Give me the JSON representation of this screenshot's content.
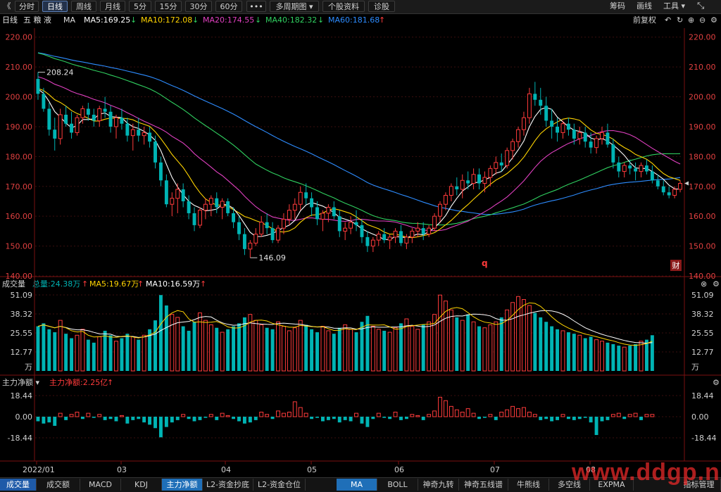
{
  "toolbar": {
    "collapse_glyph": "《",
    "periods": [
      "分时",
      "日线",
      "周线",
      "月线",
      "5分",
      "15分",
      "30分",
      "60分",
      "•••",
      "多周期图 ▾",
      "个股资料",
      "诊股"
    ],
    "selected_period": "日线",
    "right_items": [
      "筹码",
      "画线",
      "工具 ▾"
    ],
    "expand_glyph": "⤡"
  },
  "main_info": {
    "period_label": "日线",
    "stock_name": "五 粮 液",
    "indicator": "MA",
    "ma5": "MA5:169.25",
    "ma10": "MA10:172.08",
    "ma20": "MA20:174.55",
    "ma40": "MA40:182.32",
    "ma60": "MA60:181.68",
    "ma5_arrow": "↓",
    "ma10_arrow": "↓",
    "ma20_arrow": "↓",
    "ma40_arrow": "↓",
    "ma60_arrow": "↑",
    "adjust": "前复权"
  },
  "price_chart": {
    "y_ticks": [
      "220.00",
      "210.00",
      "200.00",
      "190.00",
      "180.00",
      "170.00",
      "160.00",
      "150.00",
      "140.00"
    ],
    "y_range": [
      140,
      223
    ],
    "high_label": "208.24",
    "low_label": "146.09",
    "q_marker": "q",
    "fin_marker": "财"
  },
  "volume_info": {
    "label": "成交量",
    "total": "总量:24.38万",
    "total_arrow": "↑",
    "ma5": "MA5:19.67万",
    "ma5_arrow": "↑",
    "ma10": "MA10:16.59万",
    "ma10_arrow": "↑"
  },
  "volume_chart": {
    "y_ticks": [
      "51.09",
      "38.32",
      "25.55",
      "12.77",
      "万"
    ],
    "y_range": [
      0,
      51.09
    ]
  },
  "fund_info": {
    "label": "主力净额 ▾",
    "value": "主力净额:2.25亿",
    "value_arrow": "↑"
  },
  "fund_chart": {
    "y_ticks": [
      "18.44",
      "0.00",
      "-18.44"
    ],
    "y_range": [
      -18.44,
      18.44
    ]
  },
  "date_axis": [
    "2022/01",
    "03",
    "04",
    "05",
    "06",
    "07",
    "08"
  ],
  "bottom_tabs_left": [
    "成交量",
    "成交额",
    "MACD",
    "KDJ",
    "主力净额",
    "L2-资金抄底",
    "L2-资金仓位"
  ],
  "bottom_tabs_right": [
    "MA",
    "BOLL",
    "神奇九转",
    "神奇五线谱",
    "牛熊线",
    "多空线",
    "EXPMA",
    "指标管理"
  ],
  "watermark": "www.ddgp.net",
  "colors": {
    "up": "#ff3b3b",
    "down": "#00b4b4",
    "ma5": "#ffffff",
    "ma10": "#ffd400",
    "ma20": "#e040c0",
    "ma40": "#30d060",
    "ma60": "#2d8cff",
    "accent": "#1e5aa8"
  },
  "chart_data": {
    "type": "candlestick",
    "title": "五粮液 日线",
    "ohlc": [
      [
        206,
        208.24,
        199,
        201
      ],
      [
        201,
        203,
        195,
        196
      ],
      [
        196,
        198,
        187,
        189
      ],
      [
        189,
        193,
        182,
        186
      ],
      [
        186,
        196,
        184,
        194
      ],
      [
        194,
        197,
        190,
        191
      ],
      [
        191,
        195,
        186,
        188
      ],
      [
        188,
        194,
        187,
        193
      ],
      [
        193,
        197,
        191,
        196
      ],
      [
        196,
        198,
        192,
        194
      ],
      [
        194,
        196,
        190,
        192
      ],
      [
        192,
        197,
        190,
        196
      ],
      [
        196,
        200,
        193,
        195
      ],
      [
        195,
        197,
        188,
        190
      ],
      [
        190,
        194,
        186,
        193
      ],
      [
        193,
        196,
        189,
        191
      ],
      [
        191,
        193,
        185,
        187
      ],
      [
        187,
        191,
        182,
        189
      ],
      [
        189,
        193,
        185,
        187
      ],
      [
        187,
        190,
        184,
        188
      ],
      [
        188,
        190,
        183,
        185
      ],
      [
        185,
        187,
        176,
        178
      ],
      [
        178,
        180,
        170,
        172
      ],
      [
        172,
        174,
        163,
        164
      ],
      [
        164,
        168,
        160,
        166
      ],
      [
        166,
        171,
        161,
        169
      ],
      [
        169,
        171,
        163,
        165
      ],
      [
        165,
        167,
        159,
        161
      ],
      [
        161,
        163,
        155,
        157
      ],
      [
        157,
        163,
        156,
        162
      ],
      [
        162,
        166,
        159,
        164
      ],
      [
        164,
        167,
        160,
        166
      ],
      [
        166,
        168,
        161,
        163
      ],
      [
        163,
        166,
        159,
        165
      ],
      [
        165,
        166,
        160,
        161
      ],
      [
        161,
        163,
        156,
        158
      ],
      [
        158,
        160,
        152,
        154
      ],
      [
        154,
        156,
        147,
        149
      ],
      [
        149,
        152,
        146.09,
        151
      ],
      [
        151,
        156,
        150,
        154
      ],
      [
        154,
        160,
        153,
        158
      ],
      [
        158,
        161,
        154,
        156
      ],
      [
        156,
        158,
        151,
        152
      ],
      [
        152,
        157,
        151,
        156
      ],
      [
        156,
        161,
        154,
        159
      ],
      [
        159,
        164,
        157,
        162
      ],
      [
        162,
        166,
        159,
        164
      ],
      [
        164,
        170,
        162,
        168
      ],
      [
        168,
        171,
        164,
        166
      ],
      [
        166,
        168,
        160,
        163
      ],
      [
        163,
        165,
        157,
        159
      ],
      [
        159,
        162,
        155,
        161
      ],
      [
        161,
        164,
        158,
        163
      ],
      [
        163,
        165,
        159,
        160
      ],
      [
        160,
        162,
        153,
        155
      ],
      [
        155,
        158,
        152,
        156
      ],
      [
        156,
        160,
        154,
        158
      ],
      [
        158,
        162,
        155,
        157
      ],
      [
        157,
        159,
        151,
        153
      ],
      [
        153,
        155,
        148,
        150
      ],
      [
        150,
        153,
        148,
        152
      ],
      [
        152,
        155,
        150,
        154
      ],
      [
        154,
        156,
        151,
        152
      ],
      [
        152,
        154,
        149,
        153
      ],
      [
        153,
        156,
        151,
        155
      ],
      [
        155,
        157,
        150,
        151
      ],
      [
        151,
        154,
        149,
        153
      ],
      [
        153,
        156,
        151,
        155
      ],
      [
        155,
        158,
        153,
        156
      ],
      [
        156,
        158,
        152,
        154
      ],
      [
        154,
        157,
        153,
        156
      ],
      [
        156,
        161,
        155,
        160
      ],
      [
        160,
        165,
        158,
        164
      ],
      [
        164,
        168,
        162,
        167
      ],
      [
        167,
        171,
        165,
        170
      ],
      [
        170,
        173,
        167,
        169
      ],
      [
        169,
        174,
        166,
        172
      ],
      [
        172,
        175,
        169,
        171
      ],
      [
        171,
        176,
        169,
        174
      ],
      [
        174,
        176,
        169,
        171
      ],
      [
        171,
        175,
        168,
        173
      ],
      [
        173,
        177,
        170,
        176
      ],
      [
        176,
        180,
        174,
        178
      ],
      [
        178,
        181,
        175,
        177
      ],
      [
        177,
        183,
        176,
        182
      ],
      [
        182,
        186,
        179,
        185
      ],
      [
        185,
        190,
        183,
        189
      ],
      [
        189,
        195,
        187,
        193
      ],
      [
        193,
        203,
        191,
        201
      ],
      [
        201,
        205,
        197,
        199
      ],
      [
        199,
        203,
        194,
        197
      ],
      [
        197,
        200,
        190,
        192
      ],
      [
        192,
        196,
        186,
        190
      ],
      [
        190,
        193,
        185,
        188
      ],
      [
        188,
        192,
        186,
        191
      ],
      [
        191,
        193,
        187,
        189
      ],
      [
        189,
        191,
        184,
        186
      ],
      [
        186,
        190,
        184,
        188
      ],
      [
        188,
        190,
        183,
        185
      ],
      [
        185,
        188,
        181,
        183
      ],
      [
        183,
        187,
        181,
        186
      ],
      [
        186,
        190,
        184,
        188
      ],
      [
        188,
        191,
        183,
        184
      ],
      [
        184,
        186,
        176,
        178
      ],
      [
        178,
        180,
        173,
        175
      ],
      [
        175,
        178,
        173,
        177
      ],
      [
        177,
        179,
        174,
        176
      ],
      [
        176,
        178,
        172,
        175
      ],
      [
        175,
        178,
        173,
        177
      ],
      [
        177,
        179,
        174,
        175
      ],
      [
        175,
        177,
        171,
        172
      ],
      [
        172,
        174,
        169,
        170
      ],
      [
        170,
        172,
        167,
        168
      ],
      [
        168,
        170,
        166,
        167
      ],
      [
        167,
        170,
        166,
        169
      ],
      [
        169,
        172,
        168,
        171
      ]
    ],
    "volume": [
      30,
      32,
      28,
      26,
      34,
      25,
      22,
      24,
      28,
      21,
      19,
      23,
      27,
      24,
      20,
      22,
      25,
      23,
      21,
      24,
      28,
      34,
      51,
      44,
      38,
      36,
      30,
      27,
      33,
      39,
      34,
      31,
      29,
      26,
      28,
      30,
      32,
      36,
      38,
      34,
      31,
      29,
      28,
      33,
      30,
      27,
      29,
      34,
      31,
      28,
      26,
      30,
      27,
      25,
      29,
      31,
      28,
      26,
      33,
      37,
      30,
      28,
      27,
      26,
      29,
      32,
      35,
      30,
      28,
      31,
      33,
      38,
      51,
      47,
      41,
      36,
      34,
      38,
      33,
      30,
      29,
      31,
      33,
      36,
      41,
      46,
      50,
      48,
      44,
      39,
      36,
      33,
      30,
      28,
      27,
      26,
      25,
      24,
      22,
      23,
      21,
      20,
      19,
      18,
      17,
      16,
      17,
      18,
      20,
      21,
      24
    ],
    "fund": [
      -4,
      -6,
      -5,
      -8,
      3,
      -3,
      2,
      4,
      -2,
      3,
      -1,
      2,
      -3,
      -2,
      -4,
      1,
      -6,
      -3,
      -2,
      -5,
      -7,
      -10,
      -18,
      -9,
      -5,
      -3,
      2,
      -2,
      -4,
      -3,
      -1,
      2,
      -3,
      3,
      1,
      -2,
      -4,
      -6,
      -5,
      -3,
      4,
      2,
      -2,
      5,
      3,
      4,
      13,
      8,
      3,
      -2,
      -1,
      -4,
      -3,
      -2,
      -5,
      -3,
      -4,
      3,
      -6,
      -9,
      -2,
      3,
      -1,
      -2,
      4,
      -3,
      -2,
      2,
      1,
      -3,
      2,
      5,
      17,
      14,
      9,
      6,
      4,
      7,
      3,
      -2,
      -1,
      2,
      -3,
      4,
      6,
      9,
      7,
      8,
      4,
      2,
      -3,
      -2,
      -4,
      -3,
      2,
      -2,
      -3,
      -2,
      -1,
      -5,
      -16,
      -4,
      -3,
      2,
      3,
      -2,
      2,
      3,
      -3,
      2,
      2
    ]
  }
}
